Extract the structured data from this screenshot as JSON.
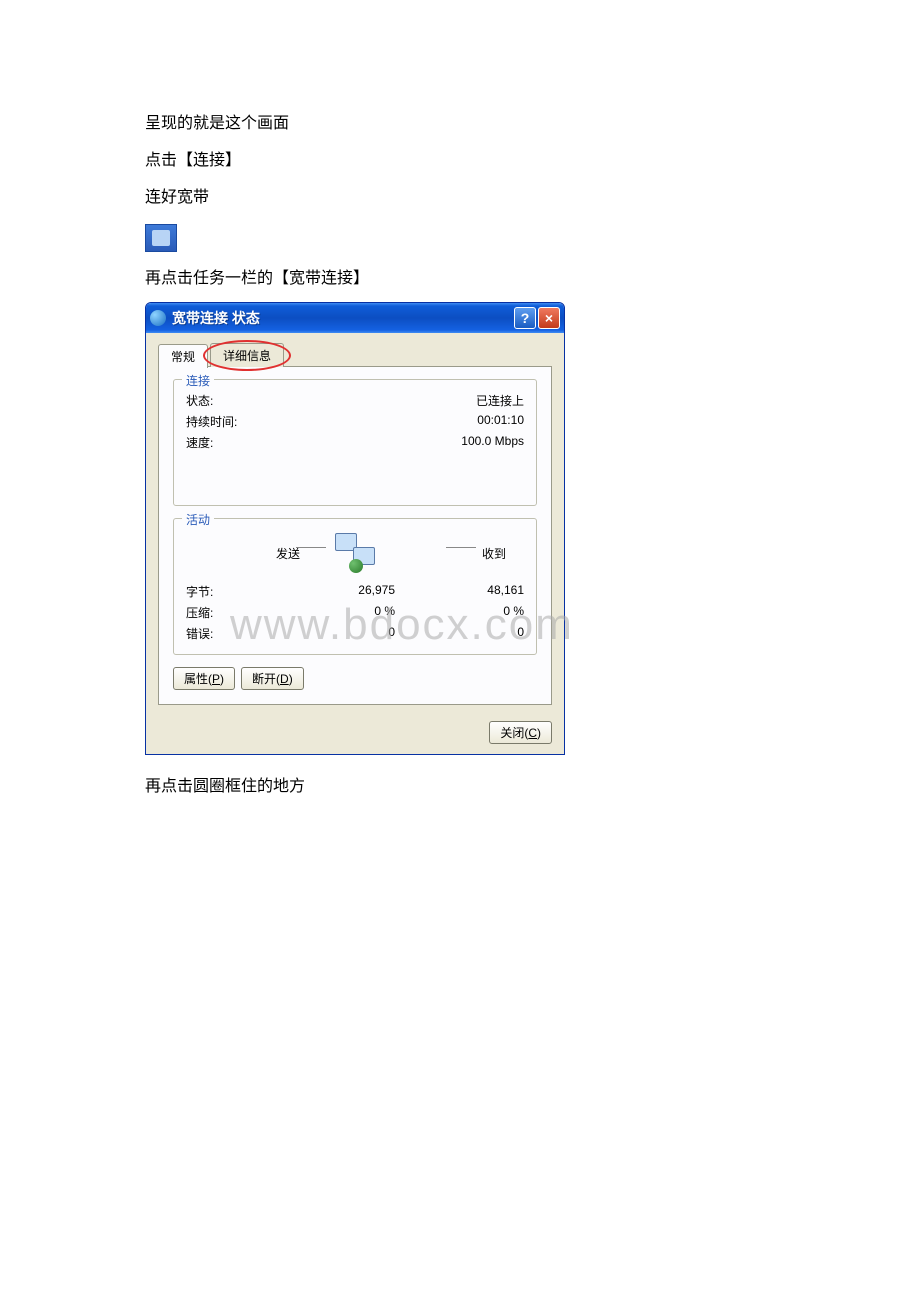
{
  "doc": {
    "line1": "呈现的就是这个画面",
    "line2": "点击【连接】",
    "line3": "连好宽带",
    "line4": "再点击任务一栏的【宽带连接】",
    "line5": "再点击圆圈框住的地方"
  },
  "watermark": "www.bdocx.com",
  "dialog": {
    "title": "宽带连接 状态",
    "help": "?",
    "close": "×",
    "tabs": {
      "general": "常规",
      "details": "详细信息"
    },
    "groups": {
      "connection": {
        "title": "连接",
        "status_label": "状态:",
        "status_value": "已连接上",
        "duration_label": "持续时间:",
        "duration_value": "00:01:10",
        "speed_label": "速度:",
        "speed_value": "100.0 Mbps"
      },
      "activity": {
        "title": "活动",
        "sent": "发送",
        "received": "收到",
        "bytes_label": "字节:",
        "bytes_sent": "26,975",
        "bytes_recv": "48,161",
        "compress_label": "压缩:",
        "compress_sent": "0 %",
        "compress_recv": "0 %",
        "errors_label": "错误:",
        "errors_sent": "0",
        "errors_recv": "0"
      }
    },
    "buttons": {
      "properties": "属性(P)",
      "disconnect": "断开(D)",
      "close": "关闭(C)"
    }
  }
}
